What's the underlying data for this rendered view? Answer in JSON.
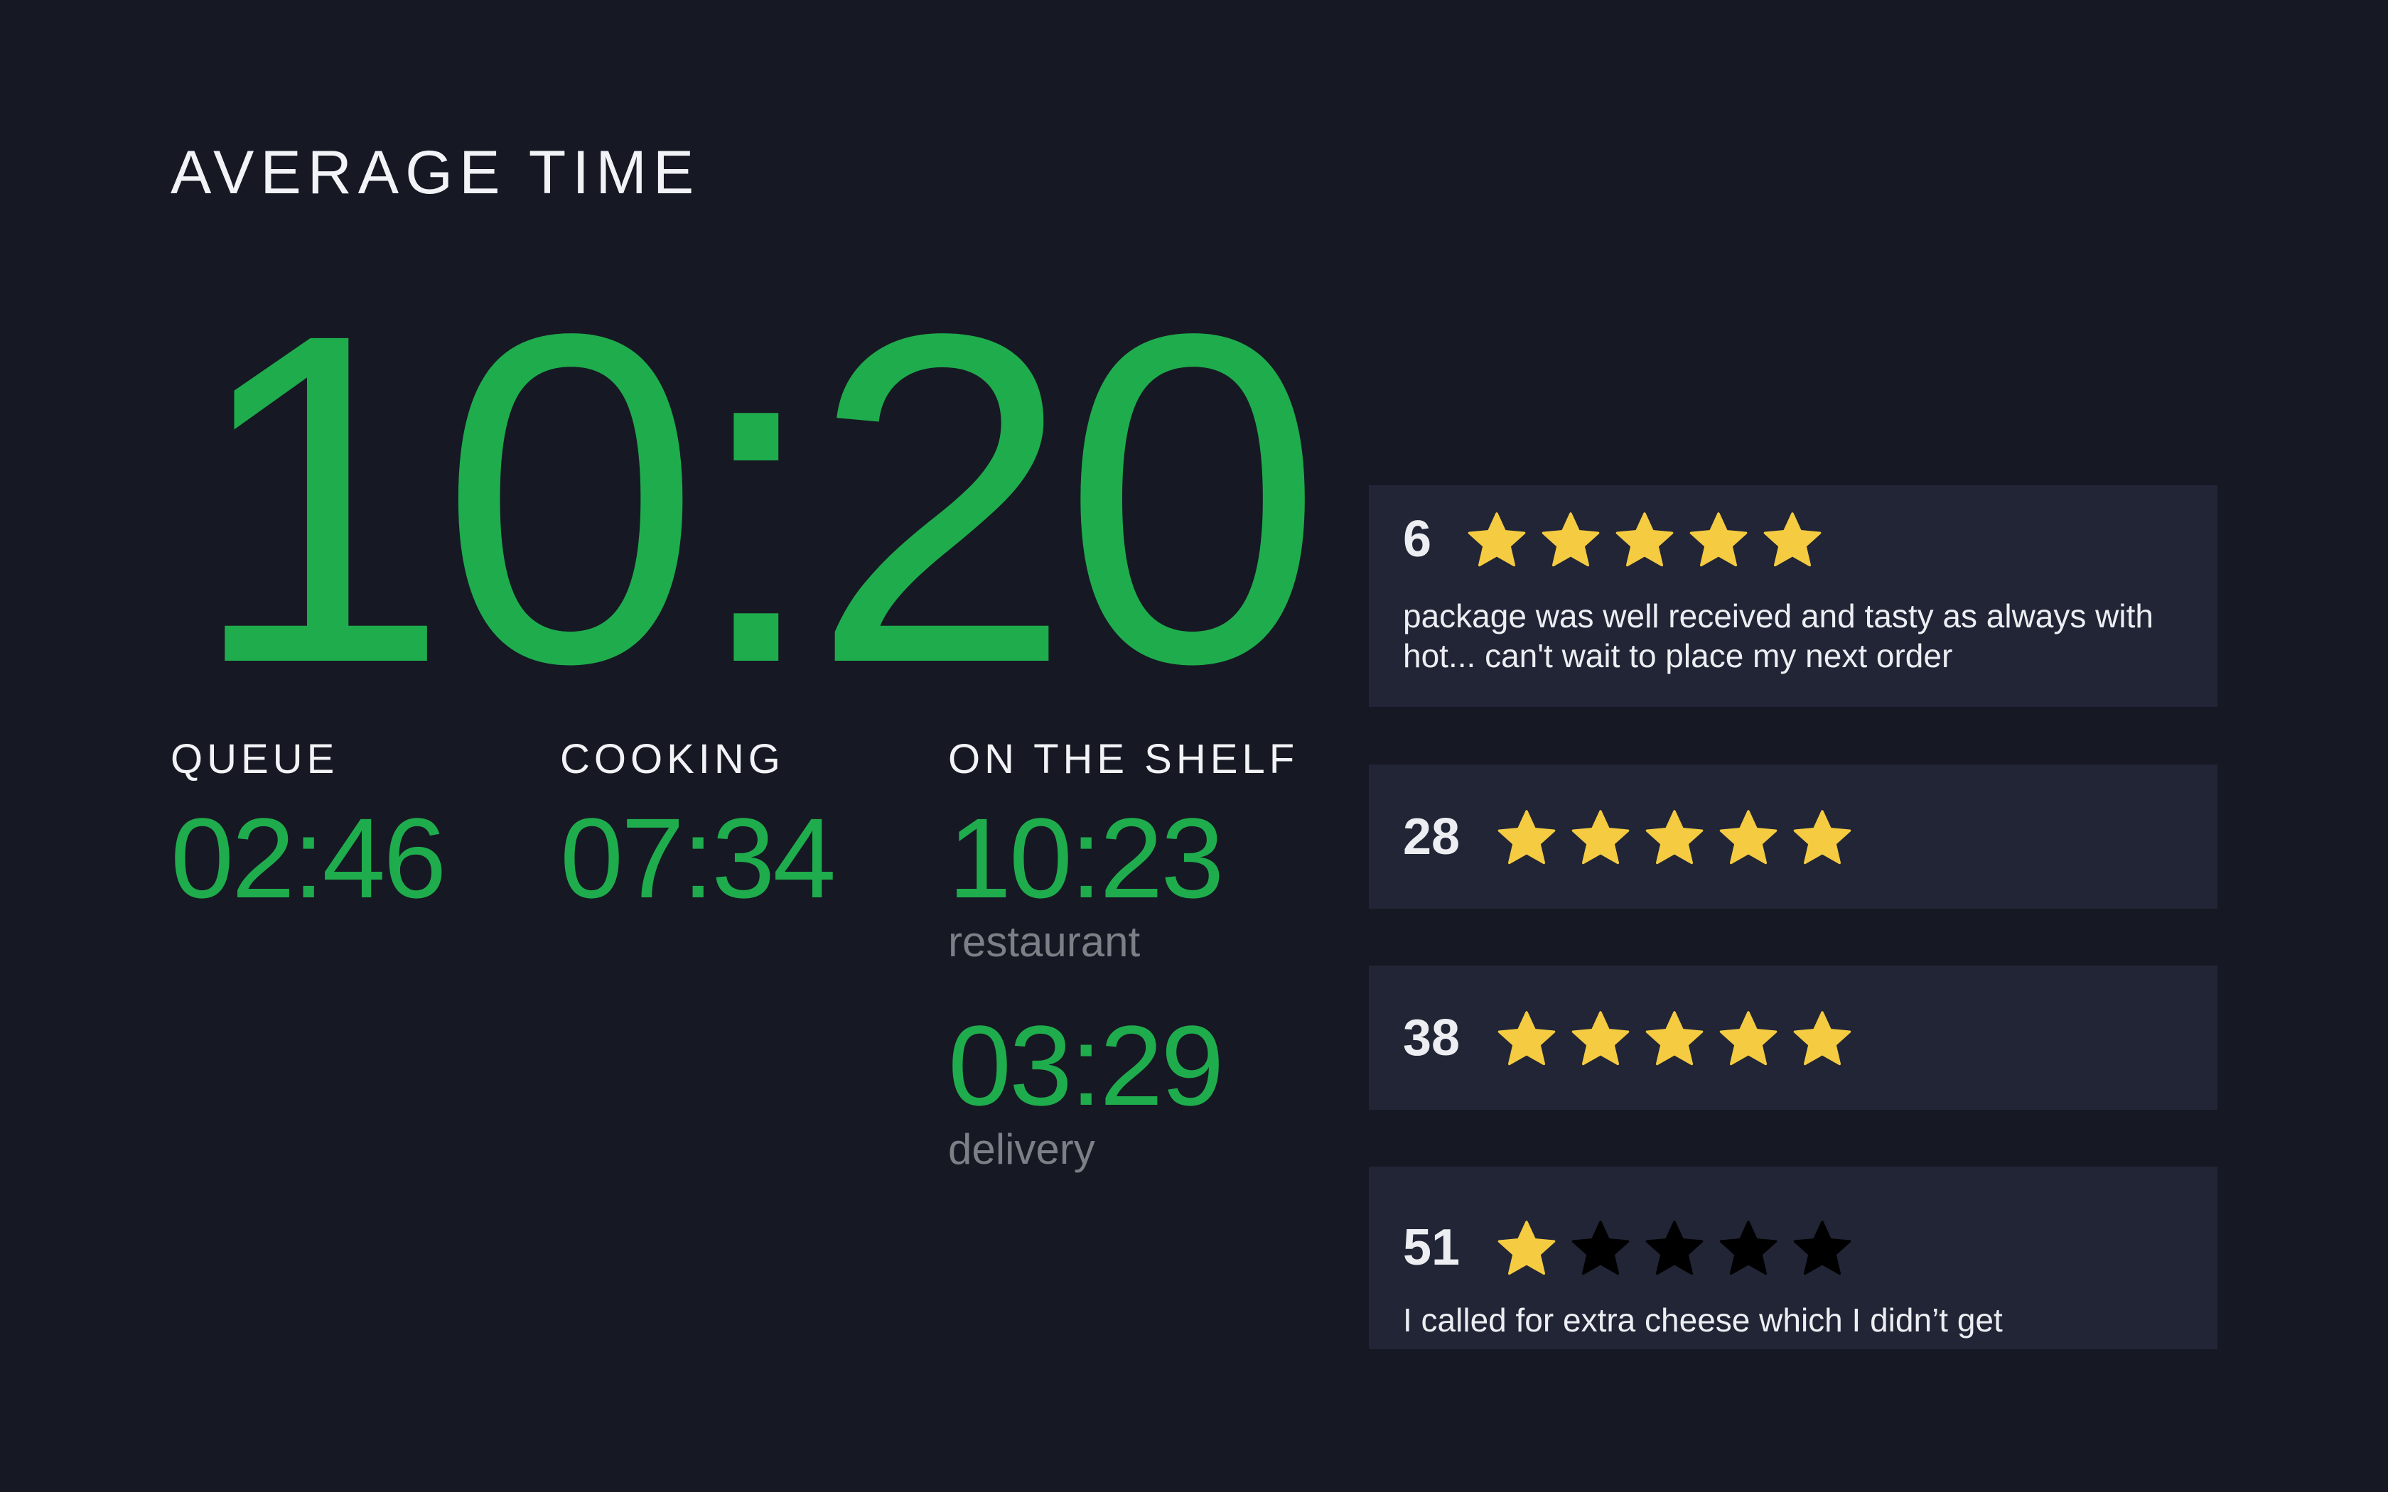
{
  "header": {
    "title": "AVERAGE TIME"
  },
  "average_time": "10:20",
  "stats": {
    "queue": {
      "label": "QUEUE",
      "value": "02:46"
    },
    "cooking": {
      "label": "COOKING",
      "value": "07:34"
    },
    "on_the_shelf": {
      "label": "ON THE SHELF",
      "restaurant": {
        "value": "10:23",
        "label": "restaurant"
      },
      "delivery": {
        "value": "03:29",
        "label": "delivery"
      }
    }
  },
  "colors": {
    "background": "#161923",
    "card": "#212536",
    "accent_green": "#1fac4d",
    "star_filled": "#f5cc41",
    "star_empty": "#000000",
    "muted_text": "#7c7f86"
  },
  "reviews": [
    {
      "id": "6",
      "rating": 5,
      "max_rating": 5,
      "comment": "package was well received and tasty as always with hot... can't wait to place my next order"
    },
    {
      "id": "28",
      "rating": 5,
      "max_rating": 5,
      "comment": ""
    },
    {
      "id": "38",
      "rating": 5,
      "max_rating": 5,
      "comment": ""
    },
    {
      "id": "51",
      "rating": 1,
      "max_rating": 5,
      "comment": "I called for extra cheese which I didn’t get"
    }
  ]
}
